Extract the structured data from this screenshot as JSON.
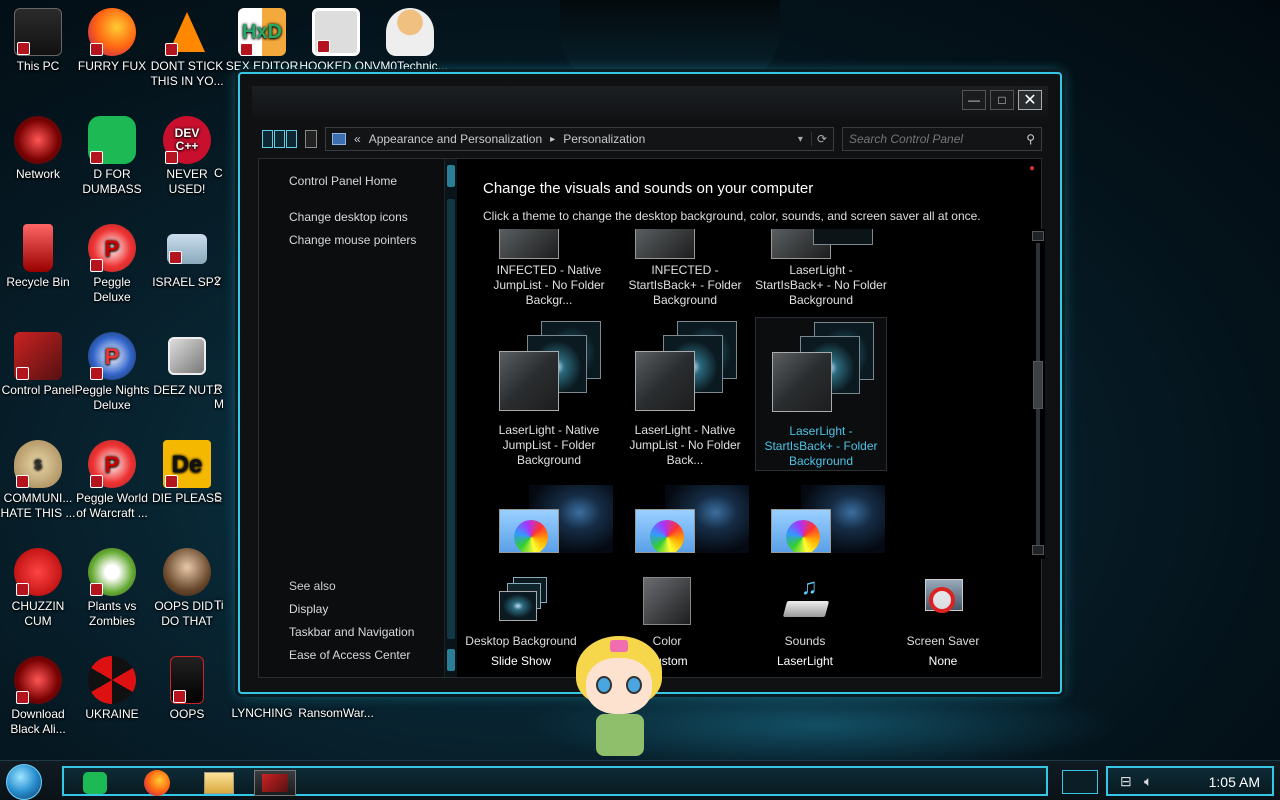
{
  "desktop": {
    "icons": [
      {
        "label": "This PC",
        "icon": "computer-icon"
      },
      {
        "label": "FURRY FUX",
        "icon": "firefox-icon"
      },
      {
        "label": "DONT STICK THIS IN YO...",
        "icon": "vlc-cone-icon"
      },
      {
        "label": "SEX EDITOR",
        "icon": "hxd-editor-icon"
      },
      {
        "label": "HOOKED ON",
        "icon": "maze-icon"
      },
      {
        "label": "VM0Technic...",
        "icon": "doctor-icon"
      },
      {
        "label": "Network",
        "icon": "network-icon"
      },
      {
        "label": "D FOR DUMBASS",
        "icon": "spotify-icon"
      },
      {
        "label": "NEVER USED!",
        "icon": "devcpp-icon",
        "badge": "DEV C++"
      },
      {
        "label": "Recycle Bin",
        "icon": "recycle-bin-icon"
      },
      {
        "label": "Peggle Deluxe",
        "icon": "peggle-icon"
      },
      {
        "label": "ISRAEL SPY",
        "icon": "remote-desktop-icon"
      },
      {
        "label": "Control Panel",
        "icon": "control-panel-icon"
      },
      {
        "label": "Peggle Nights Deluxe",
        "icon": "peggle-nights-icon"
      },
      {
        "label": "DEEZ NUTZ",
        "icon": "stacked-windows-icon"
      },
      {
        "label": "COMMUNI... HATE THIS ...",
        "icon": "money-bag-icon"
      },
      {
        "label": "Peggle World of Warcraft ...",
        "icon": "peggle-wow-icon"
      },
      {
        "label": "DIE PLEASE",
        "icon": "die-app-icon",
        "badge": "De"
      },
      {
        "label": "CHUZZIN CUM",
        "icon": "chuzzle-icon"
      },
      {
        "label": "Plants vs Zombies",
        "icon": "pvz-icon"
      },
      {
        "label": "OOPS DID I DO THAT",
        "icon": "portrait-icon"
      },
      {
        "label": "Download Black Ali...",
        "icon": "download-icon"
      },
      {
        "label": "UKRAINE",
        "icon": "radiation-icon"
      },
      {
        "label": "OOPS",
        "icon": "skull-icon"
      },
      {
        "label": "LYNCHING",
        "icon": "blank-icon"
      },
      {
        "label": "RansomWar...",
        "icon": "blank-icon"
      }
    ],
    "partial_labels": [
      "C",
      "2",
      "R",
      "M",
      "S",
      "Ti"
    ]
  },
  "window": {
    "caption_buttons": {
      "minimize": "—",
      "maximize": "□",
      "close": "✕"
    },
    "address": {
      "prefix": "«",
      "crumbs": [
        "Appearance and Personalization",
        "Personalization"
      ],
      "separator": "▸"
    },
    "search": {
      "placeholder": "Search Control Panel"
    },
    "sidebar": {
      "home": "Control Panel Home",
      "links": [
        "Change desktop icons",
        "Change mouse pointers"
      ],
      "see_also_title": "See also",
      "see_also": [
        "Display",
        "Taskbar and Navigation",
        "Ease of Access Center"
      ]
    },
    "main": {
      "title": "Change the visuals and sounds on your computer",
      "subtitle": "Click a theme to change the desktop background, color, sounds, and screen saver all at once.",
      "themes": [
        {
          "name": "INFECTED - Native JumpList - No Folder Backgr..."
        },
        {
          "name": "INFECTED - StartIsBack+ - Folder Background"
        },
        {
          "name": "LaserLight - StartIsBack+ - No Folder Background"
        },
        {
          "name": "LaserLight - Native JumpList - Folder Background"
        },
        {
          "name": "LaserLight - Native JumpList - No Folder Back..."
        },
        {
          "name": "LaserLight - StartIsBack+ - Folder Background",
          "selected": true
        }
      ],
      "settings": [
        {
          "label": "Desktop Background",
          "value": "Slide Show"
        },
        {
          "label": "Color",
          "value": "Custom"
        },
        {
          "label": "Sounds",
          "value": "LaserLight"
        },
        {
          "label": "Screen Saver",
          "value": "None"
        }
      ]
    }
  },
  "taskbar": {
    "clock": "1:05 AM",
    "buttons": [
      "spotify-icon",
      "firefox-icon",
      "file-explorer-icon",
      "control-panel-icon"
    ]
  },
  "colors": {
    "accent": "#36c6e6",
    "selected_text": "#4ec4e6"
  }
}
